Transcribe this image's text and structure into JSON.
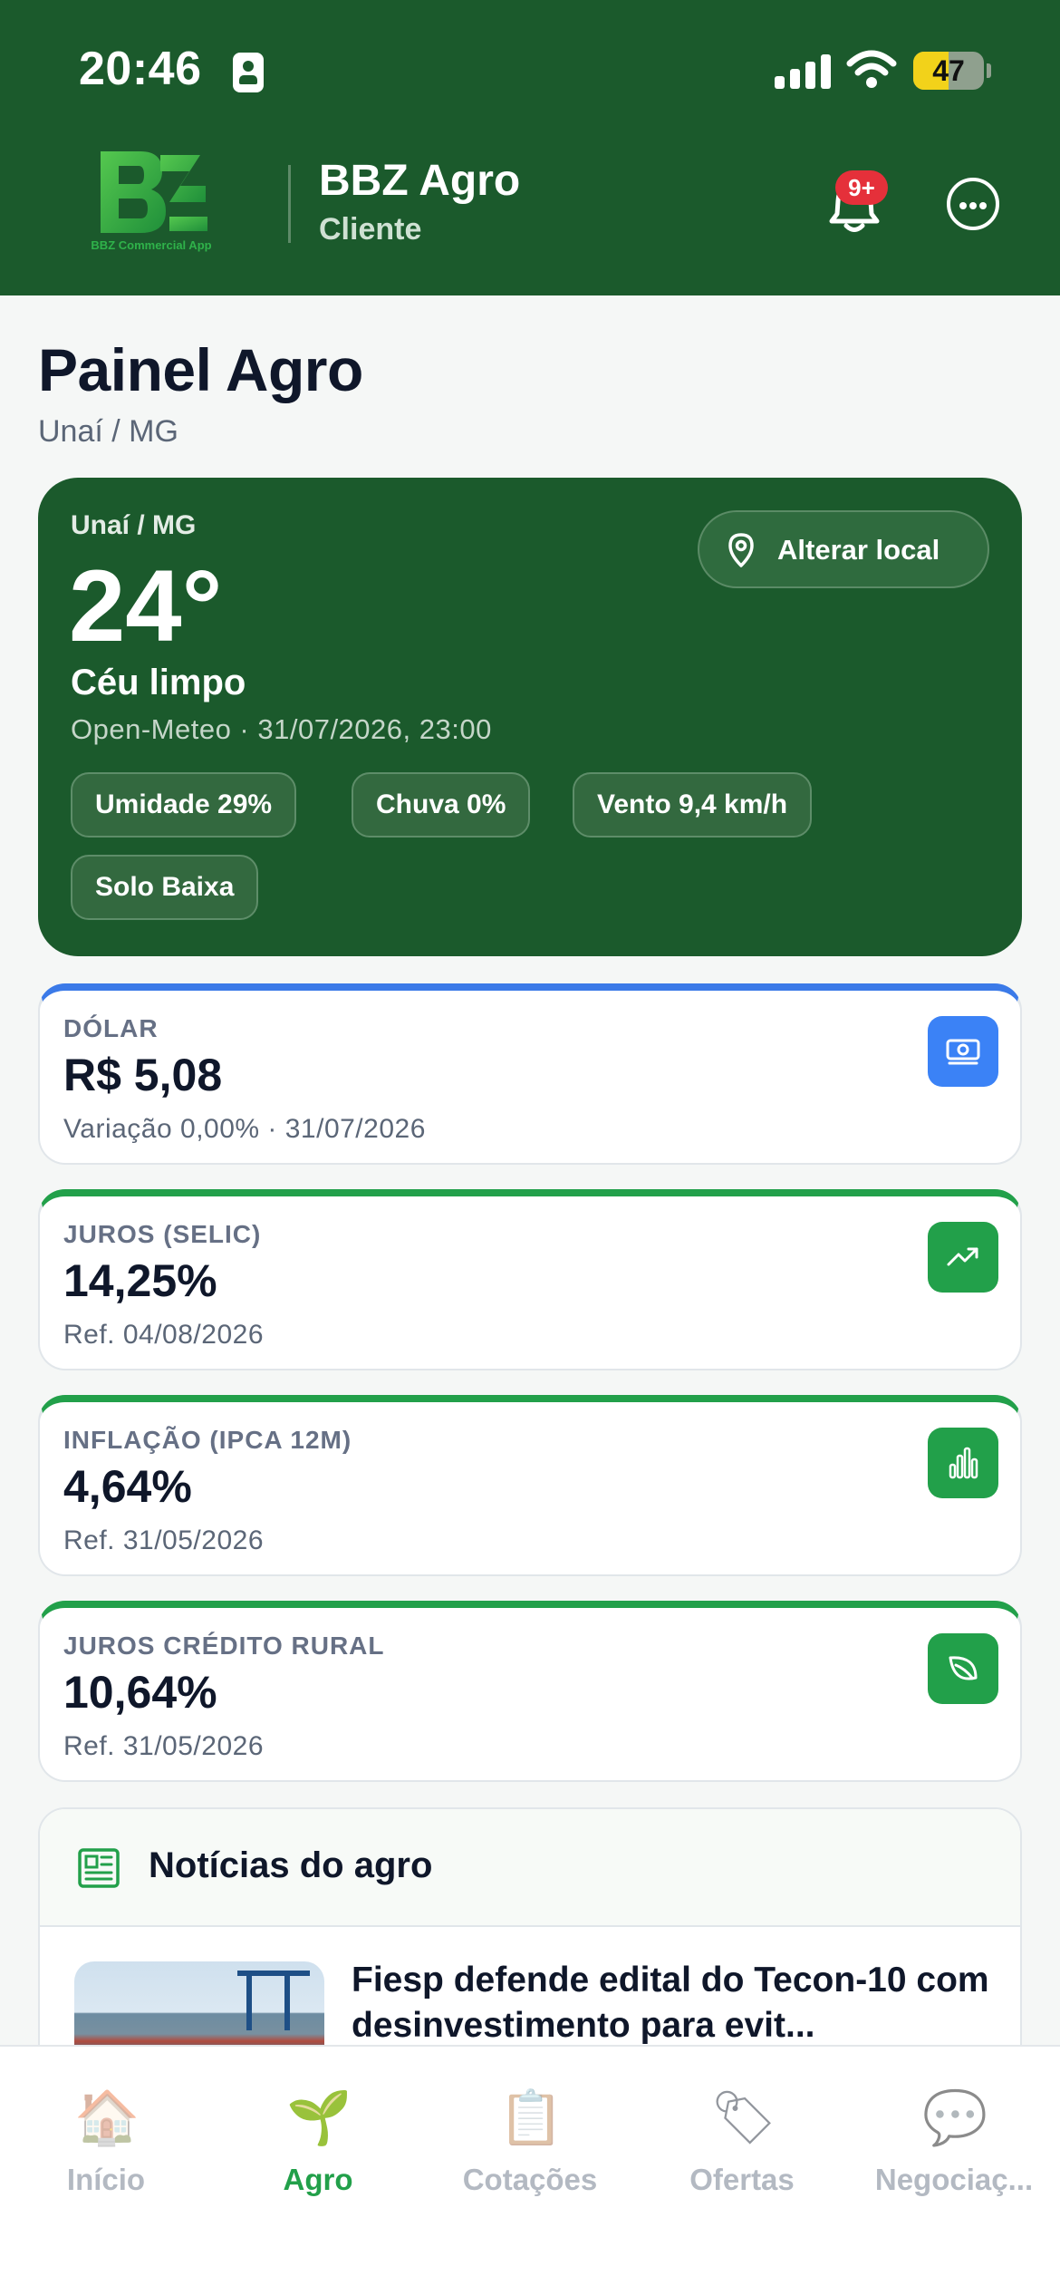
{
  "status_bar": {
    "time": "20:46",
    "battery": "47"
  },
  "header": {
    "logo_subtitle": "BBZ Commercial App",
    "app_name": "BBZ Agro",
    "role": "Cliente",
    "notification_badge": "9+"
  },
  "page": {
    "title": "Painel Agro",
    "subtitle": "Unaí / MG"
  },
  "weather": {
    "location": "Unaí / MG",
    "temperature": "24°",
    "condition": "Céu limpo",
    "source": "Open-Meteo · 31/07/2026, 23:00",
    "change_location_label": "Alterar local",
    "chips": [
      "Umidade 29%",
      "Chuva 0%",
      "Vento 9,4 km/h",
      "Solo Baixa"
    ]
  },
  "indicators": [
    {
      "label": "DÓLAR",
      "value": "R$ 5,08",
      "ref": "Variação 0,00% · 31/07/2026",
      "icon": "money-icon",
      "accent": "#3b82f6"
    },
    {
      "label": "JUROS (SELIC)",
      "value": "14,25%",
      "ref": "Ref. 04/08/2026",
      "icon": "trend-up-icon",
      "accent": "#22a04a"
    },
    {
      "label": "INFLAÇÃO (IPCA 12M)",
      "value": "4,64%",
      "ref": "Ref. 31/05/2026",
      "icon": "bar-chart-icon",
      "accent": "#22a04a"
    },
    {
      "label": "JUROS CRÉDITO RURAL",
      "value": "10,64%",
      "ref": "Ref. 31/05/2026",
      "icon": "leaf-icon",
      "accent": "#22a04a"
    }
  ],
  "news": {
    "title": "Notícias do agro",
    "items": [
      {
        "headline": "Fiesp defende edital do Tecon-10 com desinvestimento para evit..."
      }
    ]
  },
  "tabbar": {
    "items": [
      {
        "label": "Início",
        "icon": "house-icon",
        "active": false
      },
      {
        "label": "Agro",
        "icon": "seedling-icon",
        "active": true
      },
      {
        "label": "Cotações",
        "icon": "clipboard-icon",
        "active": false
      },
      {
        "label": "Ofertas",
        "icon": "tag-icon",
        "active": false
      },
      {
        "label": "Negociaç...",
        "icon": "speech-bubble-icon",
        "active": false
      }
    ]
  },
  "colors": {
    "brand_green": "#1b5a2c",
    "accent_green": "#22a04a",
    "accent_blue": "#3b82f6",
    "badge_red": "#e5303a"
  }
}
